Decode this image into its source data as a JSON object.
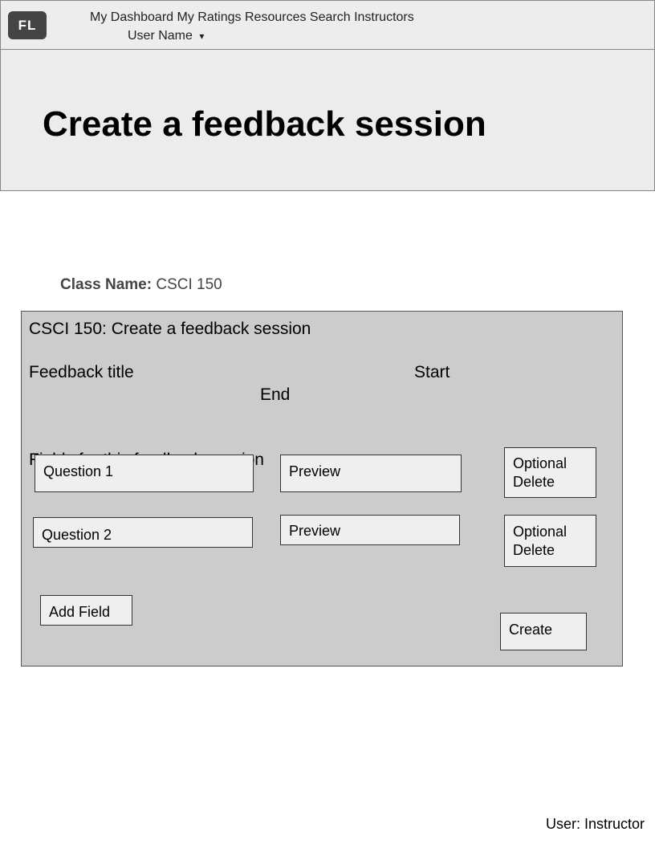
{
  "header": {
    "logo": "FL",
    "nav": [
      "My Dashboard",
      "My Ratings",
      "Resources",
      "Search Instructors"
    ],
    "user_name": "User Name",
    "user_caret": "▾"
  },
  "hero": {
    "title": "Create a feedback session"
  },
  "class_info": {
    "label": "Class Name:",
    "value": "CSCI 150"
  },
  "panel": {
    "title": "CSCI 150: Create a feedback session",
    "feedback_title_label": "Feedback title",
    "start_label": "Start",
    "end_label": "End",
    "fields_label": "Fields for this feedback session",
    "questions": [
      {
        "label": "Question 1",
        "preview": "Preview",
        "options_line1": "Optional",
        "options_line2": "Delete"
      },
      {
        "label": "Question 2",
        "preview": "Preview",
        "options_line1": "Optional",
        "options_line2": "Delete"
      }
    ],
    "add_field": "Add Field",
    "create": "Create"
  },
  "footer": {
    "user_role": "User: Instructor"
  }
}
